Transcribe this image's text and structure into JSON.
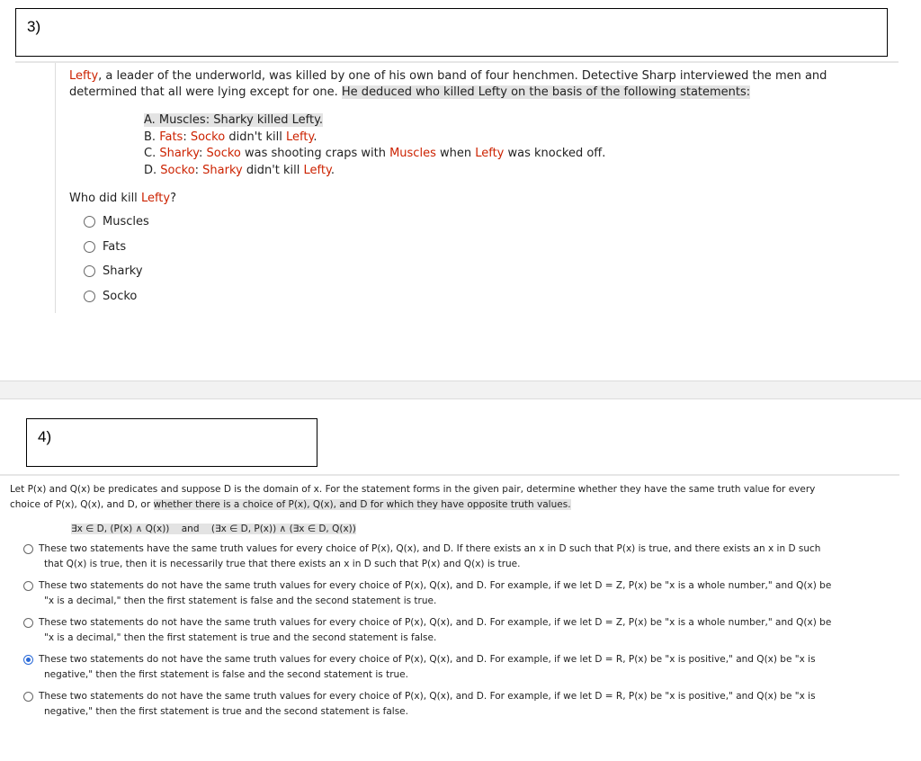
{
  "q3": {
    "number": "3)",
    "intro": {
      "name": "Lefty",
      "p1": ", a leader of the underworld, was killed by one of his own band of four henchmen. Detective Sharp interviewed the men and",
      "p2": "determined that all were lying except for one.",
      "p3": "He deduced who killed Lefty on the basis of the following statements:"
    },
    "statements": {
      "a": "A. Muscles: Sharky killed Lefty.",
      "b_prefix": "B. ",
      "b_name": "Fats",
      "b_colon": ": ",
      "b_who": "Socko",
      "b_mid": " didn't kill ",
      "b_lefty": "Lefty",
      "b_end": ".",
      "c_prefix": "C. ",
      "c_name": "Sharky",
      "c_colon": ": ",
      "c_who": "Socko",
      "c_mid": " was shooting craps with ",
      "c_muscles": "Muscles",
      "c_when": " when ",
      "c_lefty": "Lefty",
      "c_end": " was knocked off.",
      "d_prefix": "D. ",
      "d_name": "Socko",
      "d_colon": ": ",
      "d_who": "Sharky",
      "d_mid": " didn't kill ",
      "d_lefty": "Lefty",
      "d_end": "."
    },
    "question": {
      "pre": "Who did kill ",
      "name": "Lefty",
      "end": "?"
    },
    "options": [
      "Muscles",
      "Fats",
      "Sharky",
      "Socko"
    ]
  },
  "q4": {
    "number": "4)",
    "intro_line1": "Let P(x) and Q(x) be predicates and suppose D is the domain of x. For the statement forms in the given pair, determine whether they have the same truth value for every",
    "intro_line2a": "choice of P(x), Q(x), and D, or",
    "intro_line2b": "whether there is a choice of P(x), Q(x), and D for which they have opposite truth values.",
    "pair": "∃x ∈ D, (P(x) ∧ Q(x))    and    (∃x ∈ D, P(x)) ∧ (∃x ∈ D, Q(x))",
    "options": [
      {
        "line1": "These two statements have the same truth values for every choice of P(x), Q(x), and D. If there exists an x in D such that P(x) is true, and there exists an x in D such",
        "line2": "that Q(x) is true, then it is necessarily true that there exists an x in D such that P(x) and Q(x) is true.",
        "selected": false
      },
      {
        "line1": "These two statements do not have the same truth values for every choice of P(x), Q(x), and D. For example, if we let D = Z, P(x) be \"x is a whole number,\" and Q(x) be",
        "line2": "\"x is a decimal,\" then the first statement is false and the second statement is true.",
        "selected": false
      },
      {
        "line1": "These two statements do not have the same truth values for every choice of P(x), Q(x), and D. For example, if we let D = Z, P(x) be \"x is a whole number,\" and Q(x) be",
        "line2": "\"x is a decimal,\" then the first statement is true and the second statement is false.",
        "selected": false
      },
      {
        "line1": "These two statements do not have the same truth values for every choice of P(x), Q(x), and D. For example, if we let D = R, P(x) be \"x is positive,\" and Q(x) be \"x is",
        "line2": "negative,\" then the first statement is false and the second statement is true.",
        "selected": true
      },
      {
        "line1": "These two statements do not have the same truth values for every choice of P(x), Q(x), and D. For example, if we let D = R, P(x) be \"x is positive,\" and Q(x) be \"x is",
        "line2": "negative,\" then the first statement is true and the second statement is false.",
        "selected": false
      }
    ]
  },
  "colors": {
    "accent_red": "#cc2200",
    "highlight": "#e3e3e3",
    "radio_selected": "#2a6ad8"
  }
}
